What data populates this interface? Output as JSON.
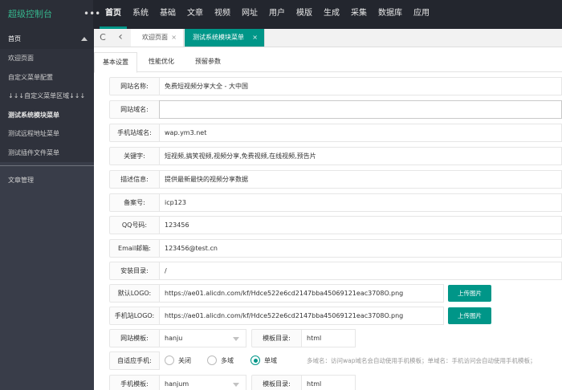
{
  "header": {
    "brand": "超级控制台",
    "more": "•••",
    "nav": [
      "首页",
      "系统",
      "基础",
      "文章",
      "视频",
      "网址",
      "用户",
      "模版",
      "生成",
      "采集",
      "数据库",
      "应用"
    ]
  },
  "sidebar": {
    "head": "首页",
    "items": [
      "欢迎页面",
      "自定义菜单配置",
      "↓↓↓自定义菜单区域↓↓↓",
      "测试系统模块菜单",
      "测试远程地址菜单",
      "测试插件文件菜单"
    ],
    "bottom": "文章管理"
  },
  "tabbar": {
    "refresh": "C",
    "back": "‹",
    "tabs": [
      {
        "label": "欢迎页面",
        "close": "×"
      },
      {
        "label": "测试系统模块菜单",
        "close": "×"
      }
    ]
  },
  "subtabs": [
    "基本设置",
    "性能优化",
    "预留参数"
  ],
  "form": {
    "site_name": {
      "label": "网站名称:",
      "value": "免费短视频分享大全 - 大中国"
    },
    "site_domain": {
      "label": "网站域名:",
      "value": ""
    },
    "mobile_domain": {
      "label": "手机站域名:",
      "value": "wap.ym3.net"
    },
    "keywords": {
      "label": "关键字:",
      "value": "短视频,搞笑视频,视频分享,免费视频,在线视频,预告片"
    },
    "description": {
      "label": "描述信息:",
      "value": "提供最新最快的视频分享数据"
    },
    "icp": {
      "label": "备案号:",
      "value": "icp123"
    },
    "qq": {
      "label": "QQ号码:",
      "value": "123456"
    },
    "email": {
      "label": "Email邮箱:",
      "value": "123456@test.cn"
    },
    "install_dir": {
      "label": "安装目录:",
      "value": "/"
    },
    "logo": {
      "label": "默认LOGO:",
      "value": "https://ae01.alicdn.com/kf/Hdce522e6cd2147bba45069121eac3708O.png",
      "button": "上传图片"
    },
    "mobile_logo": {
      "label": "手机站LOGO:",
      "value": "https://ae01.alicdn.com/kf/Hdce522e6cd2147bba45069121eac3708O.png",
      "button": "上传图片"
    },
    "template": {
      "label": "网站模板:",
      "value": "hanju",
      "dir_label": "模板目录:",
      "dir_value": "html"
    },
    "adaptive": {
      "label": "自适应手机:",
      "options": [
        "关闭",
        "多域",
        "单域"
      ],
      "selected": "单域",
      "hint": "多域名：访问wap域名会自动使用手机模板；单域名：手机访问会自动使用手机模板；"
    },
    "mobile_template": {
      "label": "手机模板:",
      "value": "hanjum",
      "dir_label": "模板目录:",
      "dir_value": "html"
    }
  },
  "colors": {
    "accent": "#009688",
    "topbar": "#23262e",
    "sidebar": "#393d49",
    "brand": "#36b58d"
  }
}
